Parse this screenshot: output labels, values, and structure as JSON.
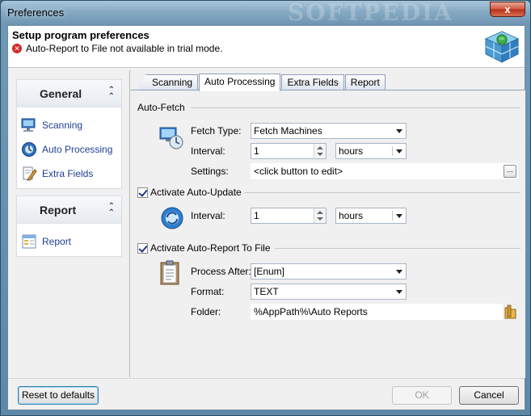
{
  "window": {
    "title": "Preferences",
    "close_glyph": "x"
  },
  "header": {
    "title": "Setup program preferences",
    "warning": "Auto-Report to File not available in trial mode."
  },
  "sidebar": {
    "groups": [
      {
        "title": "General",
        "collapse_glyph": "«",
        "items": [
          {
            "label": "Scanning",
            "icon": "scan-monitor-icon"
          },
          {
            "label": "Auto Processing",
            "icon": "auto-process-icon"
          },
          {
            "label": "Extra Fields",
            "icon": "pencil-icon"
          }
        ]
      },
      {
        "title": "Report",
        "collapse_glyph": "«",
        "items": [
          {
            "label": "Report",
            "icon": "report-icon"
          }
        ]
      }
    ]
  },
  "tabs": [
    {
      "label": "Scanning",
      "active": false
    },
    {
      "label": "Auto Processing",
      "active": true
    },
    {
      "label": "Extra Fields",
      "active": false
    },
    {
      "label": "Report",
      "active": false
    }
  ],
  "auto_fetch": {
    "title": "Auto-Fetch",
    "fetch_type_label": "Fetch Type:",
    "fetch_type_value": "Fetch Machines",
    "interval_label": "Interval:",
    "interval_value": "1",
    "interval_unit": "hours",
    "settings_label": "Settings:",
    "settings_value": "<click button to edit>",
    "settings_button": "..."
  },
  "auto_update": {
    "title": "Activate Auto-Update",
    "checked": true,
    "interval_label": "Interval:",
    "interval_value": "1",
    "interval_unit": "hours"
  },
  "auto_report": {
    "title": "Activate Auto-Report To File",
    "checked": true,
    "process_after_label": "Process After:",
    "process_after_value": "[Enum]",
    "format_label": "Format:",
    "format_value": "TEXT",
    "folder_label": "Folder:",
    "folder_value": "%AppPath%\\Auto Reports"
  },
  "footer": {
    "reset_label": "Reset to defaults",
    "ok_label": "OK",
    "cancel_label": "Cancel"
  },
  "colors": {
    "link": "#1f3f96",
    "warning": "#d22a2a",
    "window_frame": "#6f98b6"
  }
}
